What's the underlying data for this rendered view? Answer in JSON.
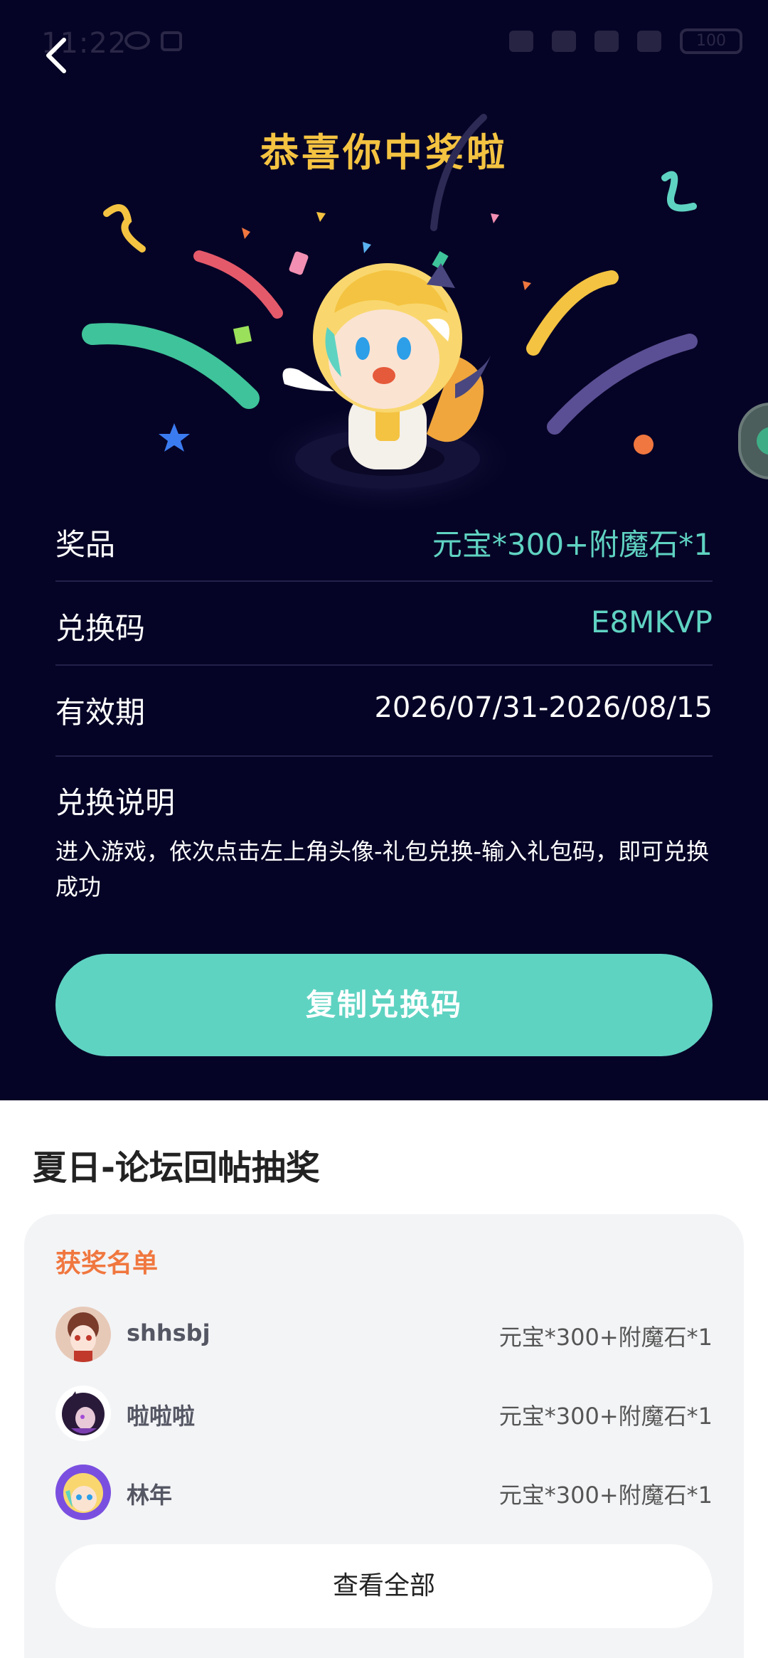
{
  "status_bar": {
    "time": "11:22",
    "battery": "100"
  },
  "header": {
    "title": "恭喜你中奖啦"
  },
  "details": [
    {
      "label": "奖品",
      "value": "元宝*300+附魔石*1"
    },
    {
      "label": "兑换码",
      "value": "E8MKVP"
    },
    {
      "label": "有效期",
      "value": "2026/07/31-2026/08/15"
    }
  ],
  "instructions": {
    "title": "兑换说明",
    "text": "进入游戏，依次点击左上角头像-礼包兑换-输入礼包码，即可兑换成功"
  },
  "copy_button": {
    "label": "复制兑换码"
  },
  "event": {
    "title": "夏日-论坛回帖抽奖"
  },
  "winners": {
    "title": "获奖名单",
    "list": [
      {
        "name": "shhsbj",
        "prize": "元宝*300+附魔石*1"
      },
      {
        "name": "啦啦啦",
        "prize": "元宝*300+附魔石*1"
      },
      {
        "name": "林年",
        "prize": "元宝*300+附魔石*1"
      }
    ],
    "view_all_label": "查看全部"
  },
  "colors": {
    "background_dark": "#060426",
    "accent_teal": "#5fd3c2",
    "title_gold": "#f4c341",
    "winners_title_orange": "#f0773f"
  }
}
